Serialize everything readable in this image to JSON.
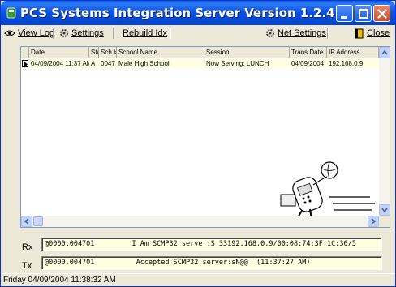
{
  "window": {
    "title": "PCS Systems Integration Server Version 1.2.4"
  },
  "toolbar": {
    "view_log": "View Log",
    "settings": "Settings",
    "rebuild_idx": "Rebuild Idx",
    "net_settings": "Net Settings",
    "close": "Close"
  },
  "table": {
    "columns": [
      "Date",
      "Sta",
      "Sch #",
      "School Name",
      "Session",
      "Trans Date",
      "IP Address"
    ],
    "rows": [
      [
        "04/09/2004 11:37 AM",
        "A",
        "0047",
        "Male High School",
        "Now Serving: LUNCH",
        "04/09/2004",
        "192.168.0.9"
      ]
    ]
  },
  "comm": {
    "rx_label": "Rx",
    "rx_text": "@0000.004701         I Am SCMP32 server:S 33192.168.0.9/00:08:74:3F:1C:30/5",
    "tx_label": "Tx",
    "tx_text": "@0000.004701          Accepted SCMP32 server:sN@@  (11:37:27 AM)"
  },
  "status": {
    "text": "Friday 04/09/2004   11:38:32 AM"
  },
  "colors": {
    "title_bar": "#0c55e2",
    "row_highlight": "#ffffe1",
    "window_bg": "#ece9d8"
  }
}
